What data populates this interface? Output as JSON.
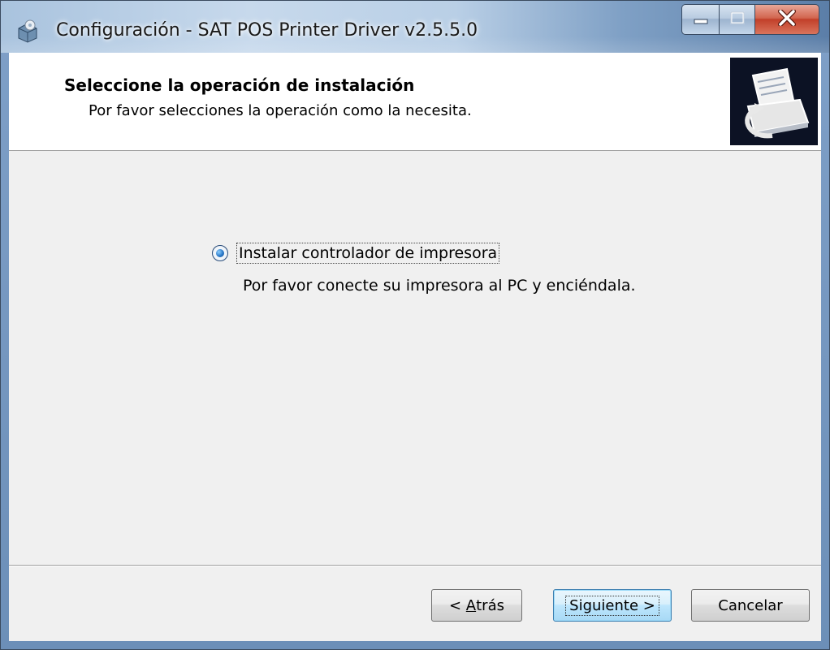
{
  "window": {
    "title": "Configuración - SAT POS Printer Driver v2.5.5.0"
  },
  "header": {
    "title": "Seleccione la operación de instalación",
    "subtitle": "Por favor selecciones la operación como la necesita."
  },
  "options": [
    {
      "label": "Instalar controlador de impresora",
      "description": "Por favor conecte su impresora al PC y enciéndala.",
      "selected": true
    }
  ],
  "buttons": {
    "back_prefix": "< ",
    "back_mnemonic": "A",
    "back_rest": "trás",
    "next_label": "Siguiente >",
    "cancel_label": "Cancelar"
  },
  "icons": {
    "app": "setup-box-icon",
    "header": "printer-install-icon",
    "minimize": "minimize-icon",
    "maximize": "maximize-icon",
    "close": "close-icon"
  },
  "colors": {
    "header_bg": "#ffffff",
    "body_bg": "#f0f0f0",
    "close_button": "#c2402a",
    "default_button_border": "#3c7fb1"
  }
}
